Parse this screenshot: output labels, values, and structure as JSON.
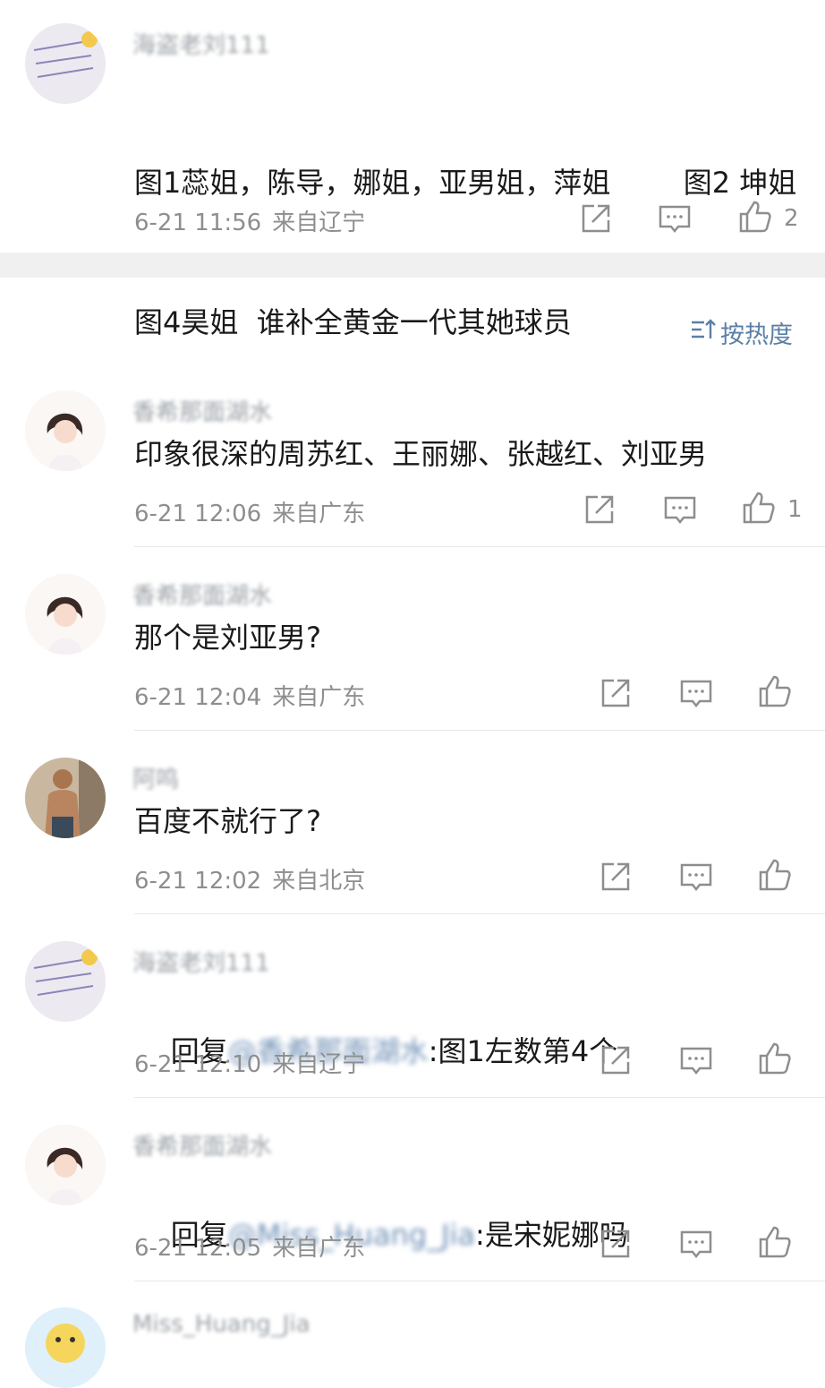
{
  "sort": {
    "icon": "sort-icon",
    "label": "按热度"
  },
  "pinned": {
    "username": "海盗老刘111",
    "body_line1": "图1蕊姐，陈导，娜姐，亚男姐，萍姐        图2 坤姐",
    "body_line2": "图4昊姐  谁补全黄金一代其她球员",
    "time": "6-21 11:56",
    "location": "来自辽宁",
    "likes": "2"
  },
  "comments": [
    {
      "username": "香希那面湖水",
      "body": "印象很深的周苏红、王丽娜、张越红、刘亚男",
      "time": "6-21 12:06",
      "location": "来自广东",
      "likes": "1"
    },
    {
      "username": "香希那面湖水",
      "body": "那个是刘亚男?",
      "time": "6-21 12:04",
      "location": "来自广东",
      "likes": ""
    },
    {
      "username": "阿鸣",
      "body": "百度不就行了?",
      "time": "6-21 12:02",
      "location": "来自北京",
      "likes": ""
    },
    {
      "username": "海盗老刘111",
      "reply_prefix": "回复",
      "mention": "@香希那面湖水",
      "reply_rest": ":图1左数第4个",
      "time": "6-21 12:10",
      "location": "来自辽宁",
      "likes": ""
    },
    {
      "username": "香希那面湖水",
      "reply_prefix": "回复",
      "mention": "@Miss_Huang_Jia",
      "reply_rest": ":是宋妮娜吗",
      "time": "6-21 12:05",
      "location": "来自广东",
      "likes": ""
    },
    {
      "username": "Miss_Huang_Jia"
    }
  ],
  "icons": {
    "share": "share-icon",
    "comment": "comment-icon",
    "like": "thumbs-up-icon"
  },
  "colors": {
    "link": "#5b7fa6",
    "meta": "#8e8e8e",
    "divider": "#f0f0f0"
  }
}
